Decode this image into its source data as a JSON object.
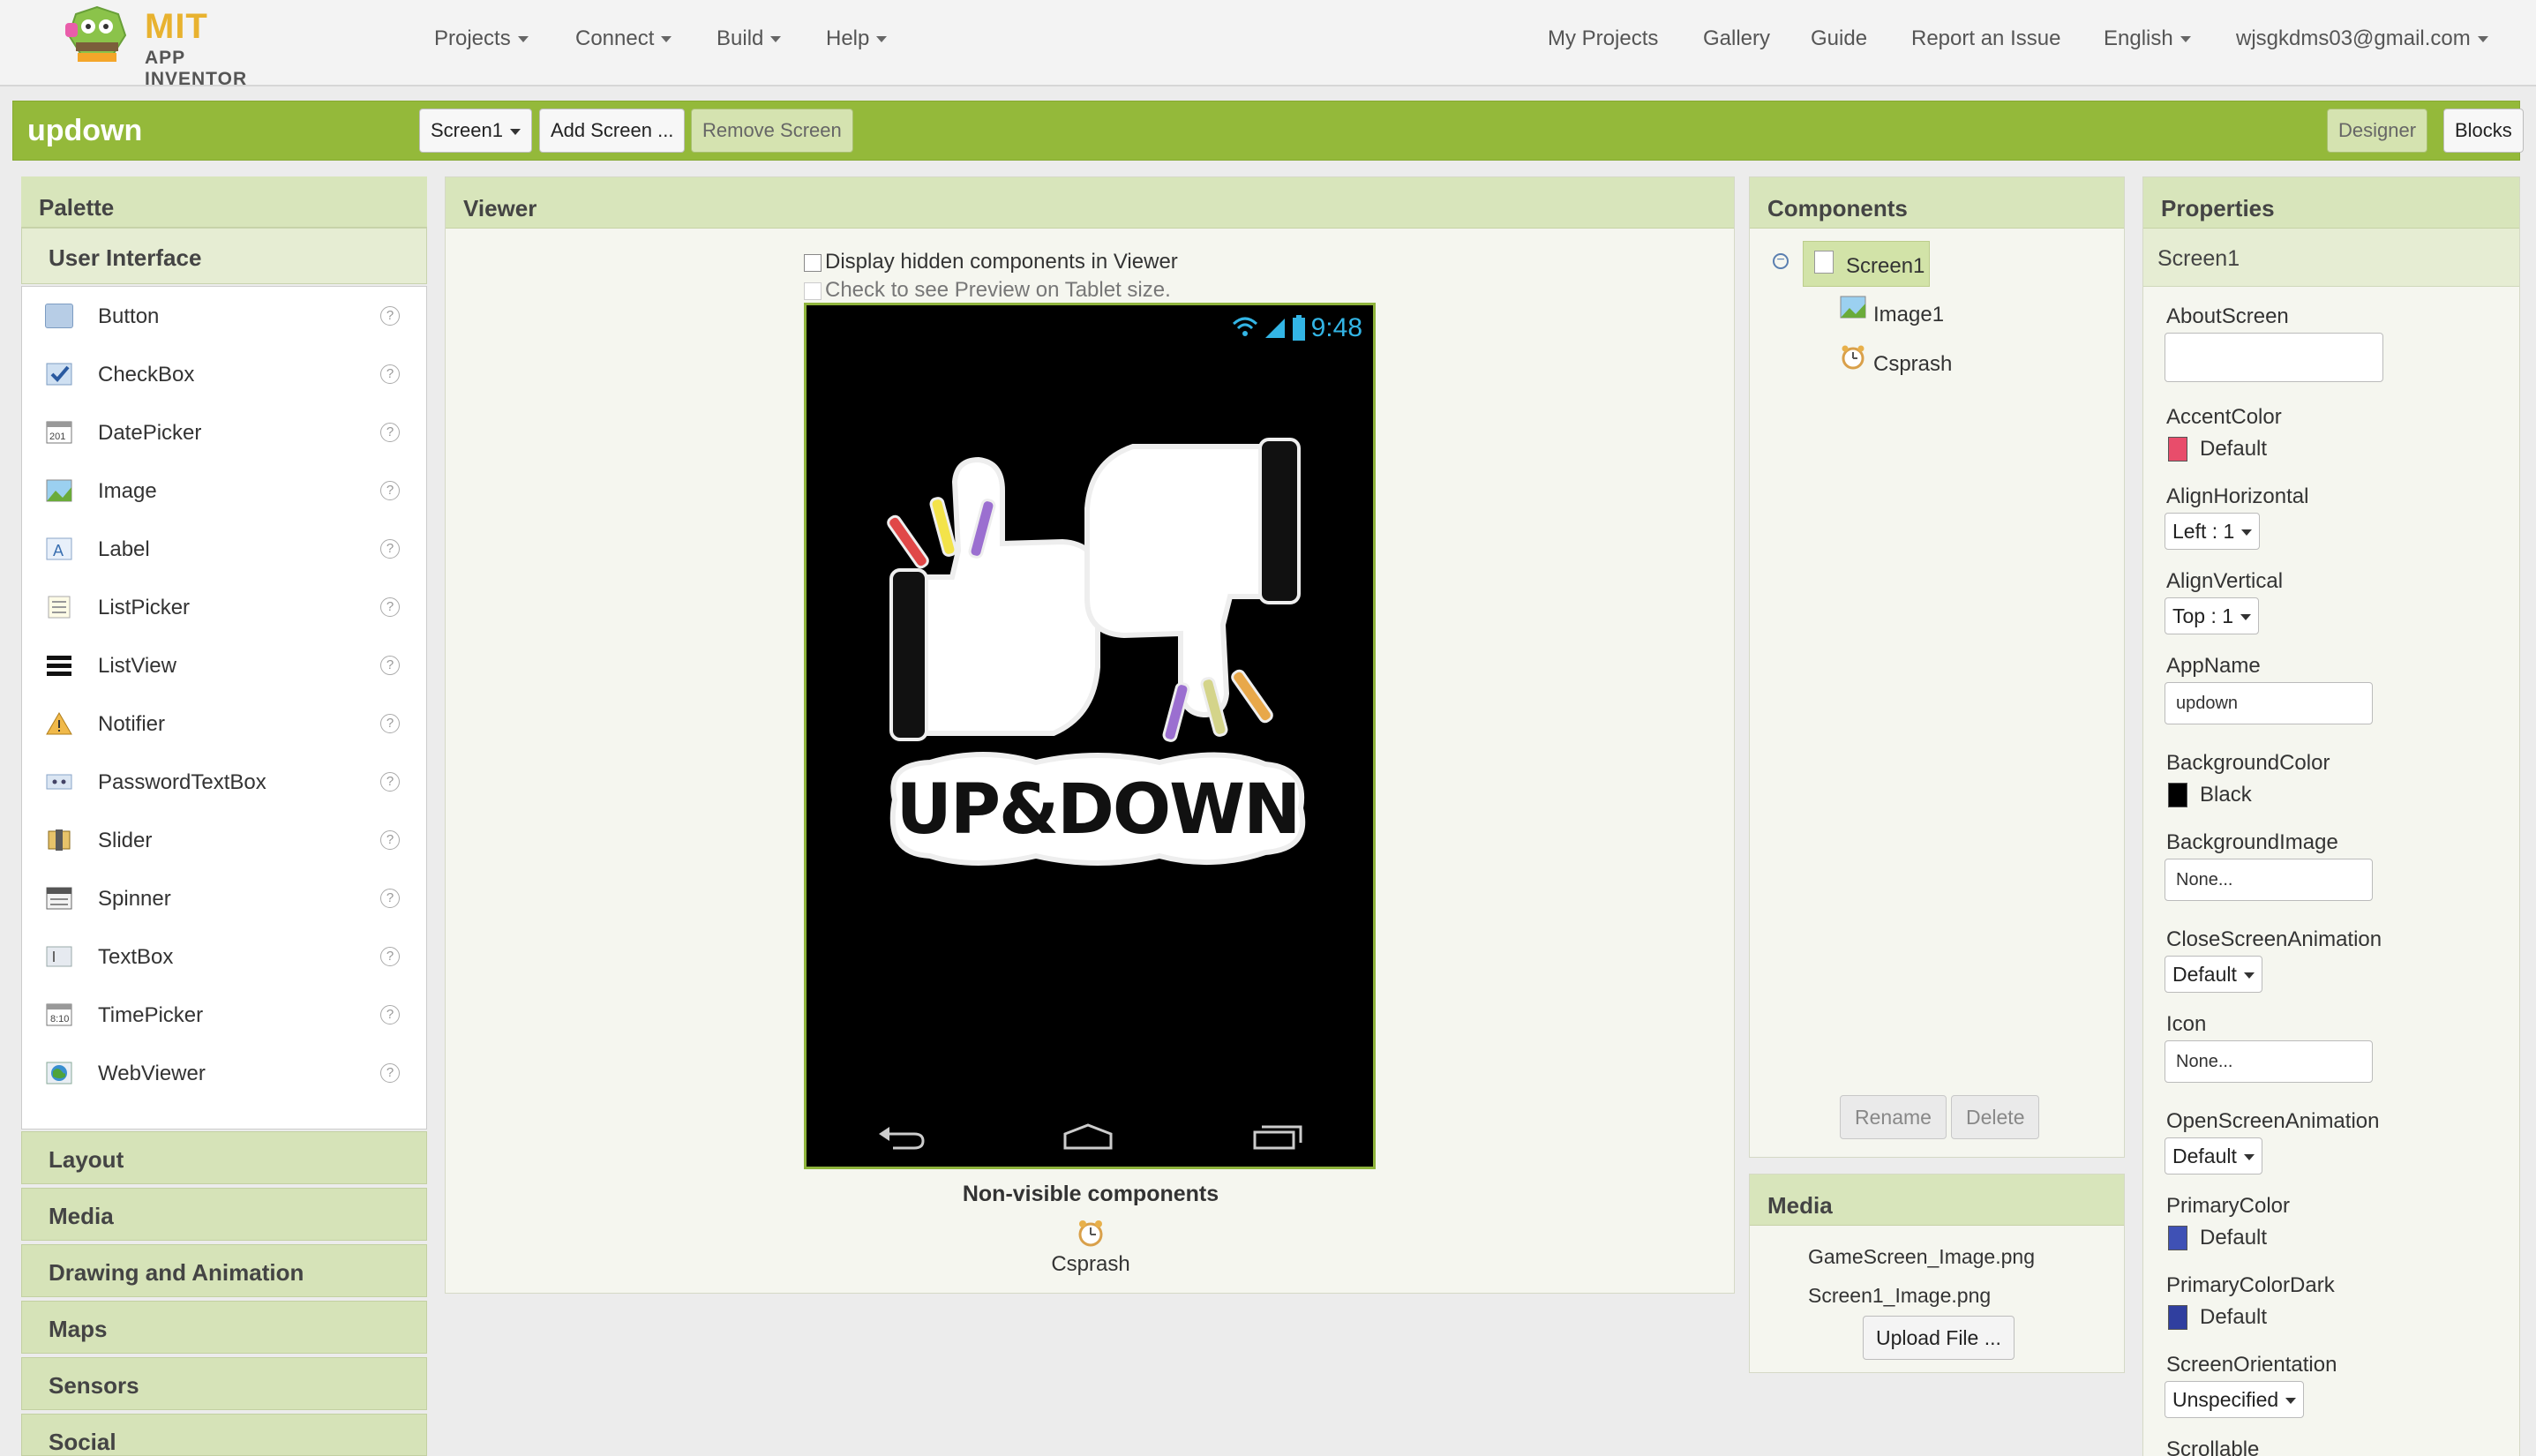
{
  "topbar": {
    "logo_mit": "MIT",
    "logo_app": "APP INVENTOR",
    "menus": [
      "Projects",
      "Connect",
      "Build",
      "Help"
    ],
    "links": [
      "My Projects",
      "Gallery",
      "Guide",
      "Report an Issue"
    ],
    "language": "English",
    "account": "wjsgkdms03@gmail.com"
  },
  "project": {
    "name": "updown",
    "screen_select": "Screen1",
    "add_screen": "Add Screen ...",
    "remove_screen": "Remove Screen",
    "designer": "Designer",
    "blocks": "Blocks"
  },
  "palette": {
    "title": "Palette",
    "category_open": "User Interface",
    "items": [
      {
        "label": "Button",
        "icon": "button-icon"
      },
      {
        "label": "CheckBox",
        "icon": "checkbox-icon"
      },
      {
        "label": "DatePicker",
        "icon": "datepicker-icon"
      },
      {
        "label": "Image",
        "icon": "image-icon"
      },
      {
        "label": "Label",
        "icon": "label-icon"
      },
      {
        "label": "ListPicker",
        "icon": "listpicker-icon"
      },
      {
        "label": "ListView",
        "icon": "listview-icon"
      },
      {
        "label": "Notifier",
        "icon": "notifier-icon"
      },
      {
        "label": "PasswordTextBox",
        "icon": "password-icon"
      },
      {
        "label": "Slider",
        "icon": "slider-icon"
      },
      {
        "label": "Spinner",
        "icon": "spinner-icon"
      },
      {
        "label": "TextBox",
        "icon": "textbox-icon"
      },
      {
        "label": "TimePicker",
        "icon": "timepicker-icon"
      },
      {
        "label": "WebViewer",
        "icon": "webviewer-icon"
      }
    ],
    "help_glyph": "?",
    "categories": [
      "Layout",
      "Media",
      "Drawing and Animation",
      "Maps",
      "Sensors",
      "Social"
    ]
  },
  "viewer": {
    "title": "Viewer",
    "hidden_checkbox": "Display hidden components in Viewer",
    "tablet_checkbox": "Check to see Preview on Tablet size.",
    "phone_time": "9:48",
    "logo_text": "UP&DOWN",
    "nonvisible_title": "Non-visible components",
    "nonvisible_item": "Csprash"
  },
  "components": {
    "title": "Components",
    "tree": [
      "Screen1",
      "Image1",
      "Csprash"
    ],
    "rename": "Rename",
    "delete": "Delete"
  },
  "media": {
    "title": "Media",
    "files": [
      "GameScreen_Image.png",
      "Screen1_Image.png"
    ],
    "upload": "Upload File ..."
  },
  "properties": {
    "title": "Properties",
    "screen": "Screen1",
    "about_label": "AboutScreen",
    "accent_label": "AccentColor",
    "accent_value": "Default",
    "accent_color": "#e84d6b",
    "alignh_label": "AlignHorizontal",
    "alignh_value": "Left : 1",
    "alignv_label": "AlignVertical",
    "alignv_value": "Top : 1",
    "appname_label": "AppName",
    "appname_value": "updown",
    "bgcolor_label": "BackgroundColor",
    "bgcolor_value": "Black",
    "bgcolor_color": "#000000",
    "bgimage_label": "BackgroundImage",
    "bgimage_value": "None...",
    "closeanim_label": "CloseScreenAnimation",
    "closeanim_value": "Default",
    "icon_label": "Icon",
    "icon_value": "None...",
    "openanim_label": "OpenScreenAnimation",
    "openanim_value": "Default",
    "primary_label": "PrimaryColor",
    "primary_value": "Default",
    "primary_color": "#3f51b5",
    "primarydark_label": "PrimaryColorDark",
    "primarydark_value": "Default",
    "primarydark_color": "#303f9f",
    "orientation_label": "ScreenOrientation",
    "orientation_value": "Unspecified",
    "scrollable_label": "Scrollable"
  }
}
